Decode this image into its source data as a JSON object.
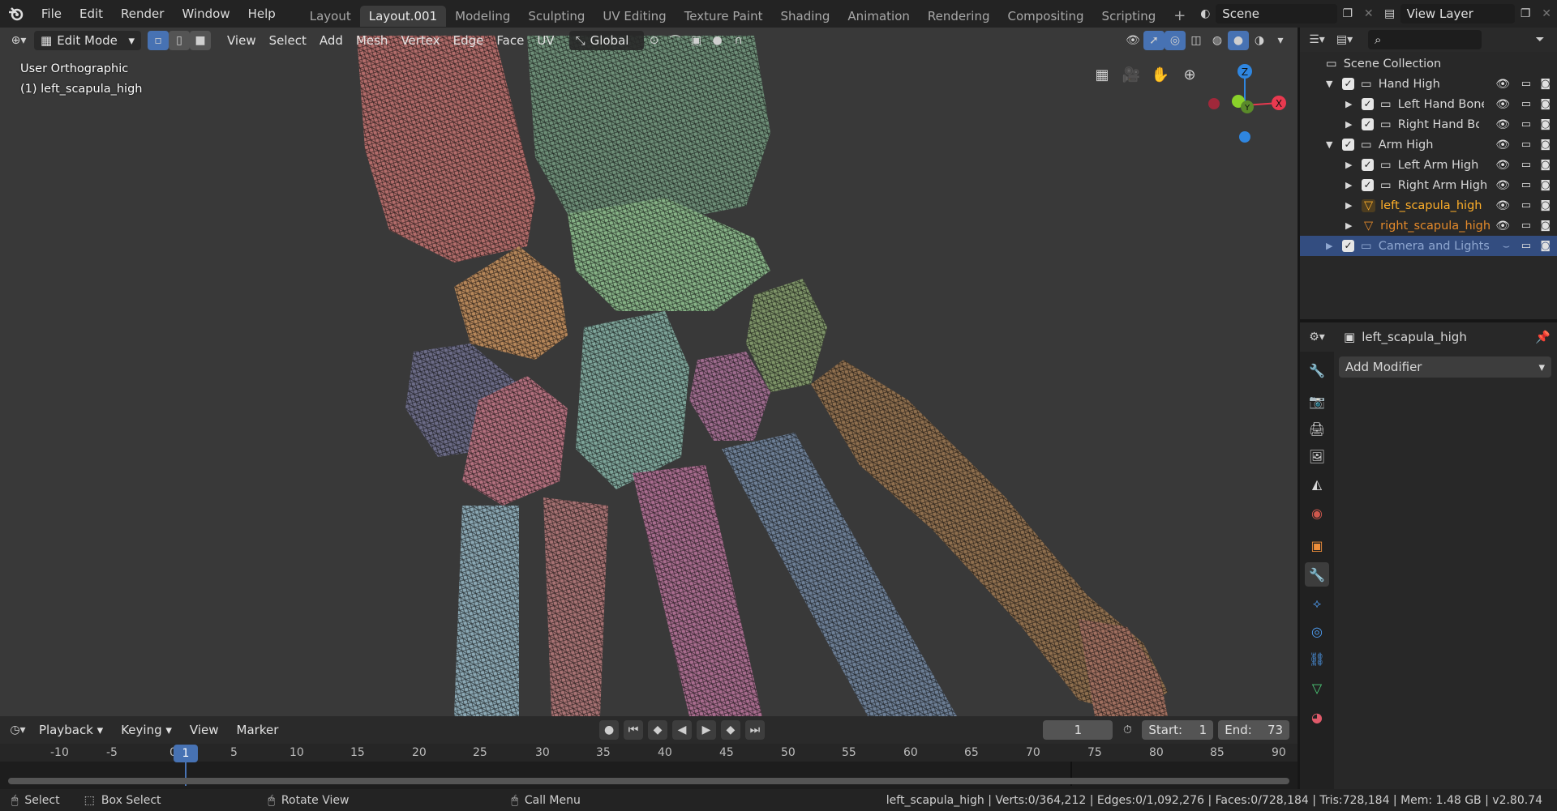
{
  "topbar": {
    "menus": [
      "File",
      "Edit",
      "Render",
      "Window",
      "Help"
    ],
    "workspaces": [
      "Layout",
      "Layout.001",
      "Modeling",
      "Sculpting",
      "UV Editing",
      "Texture Paint",
      "Shading",
      "Animation",
      "Rendering",
      "Compositing",
      "Scripting"
    ],
    "active_workspace": "Layout.001",
    "add_workspace": "+",
    "scene": "Scene",
    "view_layer": "View Layer"
  },
  "viewport": {
    "mode": "Edit Mode",
    "menus": [
      "View",
      "Select",
      "Add",
      "Mesh",
      "Vertex",
      "Edge",
      "Face",
      "UV"
    ],
    "orientation": "Global",
    "view_name": "User Orthographic",
    "object_info": "(1) left_scapula_high",
    "gizmo": {
      "x": "X",
      "y": "Y",
      "z": "Z"
    }
  },
  "outliner": {
    "rows": [
      {
        "label": "Scene Collection",
        "type": "scene"
      },
      {
        "label": "Hand High",
        "type": "collection",
        "expanded": true
      },
      {
        "label": "Left Hand Bones",
        "type": "collection",
        "expanded": false
      },
      {
        "label": "Right Hand Bones",
        "type": "collection",
        "expanded": false
      },
      {
        "label": "Arm High",
        "type": "collection",
        "expanded": true
      },
      {
        "label": "Left Arm High",
        "type": "collection",
        "expanded": false
      },
      {
        "label": "Right Arm High",
        "type": "collection",
        "expanded": false
      },
      {
        "label": "left_scapula_high",
        "type": "mesh",
        "active": true
      },
      {
        "label": "right_scapula_high",
        "type": "mesh"
      },
      {
        "label": "Camera and Lights",
        "type": "collection",
        "selected": true
      }
    ]
  },
  "properties": {
    "object_name": "left_scapula_high",
    "add_modifier": "Add Modifier"
  },
  "timeline": {
    "menus": [
      "Playback",
      "Keying",
      "View",
      "Marker"
    ],
    "current_frame": "1",
    "start_label": "Start:",
    "start": "1",
    "end_label": "End:",
    "end": "73",
    "ruler": [
      "-10",
      "-5",
      "0",
      "1",
      "5",
      "10",
      "15",
      "20",
      "25",
      "30",
      "35",
      "40",
      "45",
      "50",
      "55",
      "60",
      "65",
      "70",
      "75",
      "80",
      "85",
      "90"
    ]
  },
  "statusbar": {
    "select": "Select",
    "box_select": "Box Select",
    "rotate_view": "Rotate View",
    "call_menu": "Call Menu",
    "stats": "left_scapula_high | Verts:0/364,212 | Edges:0/1,092,276 | Faces:0/728,184 | Tris:728,184 | Mem: 1.48 GB | v2.80.74"
  },
  "colors": {
    "accent": "#4772b3",
    "active_object": "#ffaf29",
    "selected_row": "#334d80",
    "axis_x": "#e8394f",
    "axis_y": "#8ad12a",
    "axis_z": "#2f86e0"
  }
}
